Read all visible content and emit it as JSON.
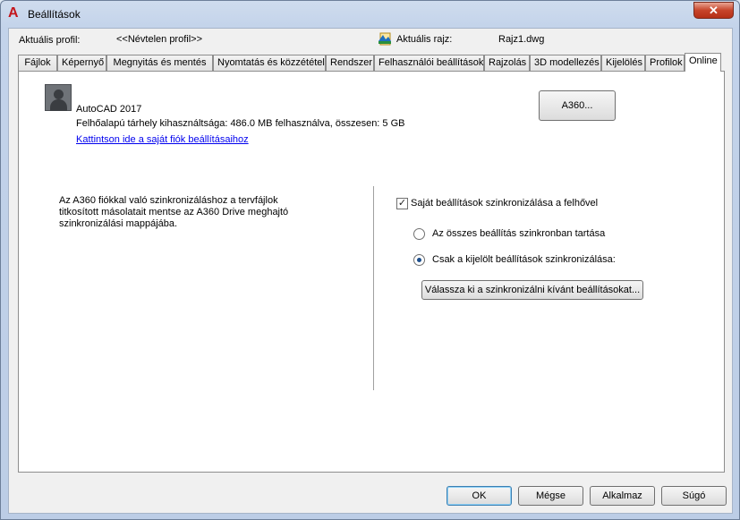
{
  "window": {
    "title": "Beállítások",
    "close_glyph": "✕"
  },
  "profile": {
    "current_profile_label": "Aktuális profil:",
    "current_profile_value": "<<Névtelen profil>>",
    "current_drawing_label": "Aktuális rajz:",
    "current_drawing_value": "Rajz1.dwg"
  },
  "tabs": [
    {
      "label": "Fájlok"
    },
    {
      "label": "Képernyő"
    },
    {
      "label": "Megnyitás és mentés"
    },
    {
      "label": "Nyomtatás és közzététel"
    },
    {
      "label": "Rendszer"
    },
    {
      "label": "Felhasználói beállítások"
    },
    {
      "label": "Rajzolás"
    },
    {
      "label": "3D modellezés"
    },
    {
      "label": "Kijelölés"
    },
    {
      "label": "Profilok"
    },
    {
      "label": "Online"
    }
  ],
  "online": {
    "product": "AutoCAD 2017",
    "storage_text": "Felhőalapú tárhely kihasználtsága: 486.0 MB felhasználva, összesen: 5 GB",
    "account_link": "Kattintson ide a saját fiók beállításaihoz",
    "a360_button": "A360...",
    "description": "Az A360 fiókkal való szinkronizáláshoz a tervfájlok titkosított másolatait mentse az A360 Drive meghajtó szinkronizálási mappájába.",
    "sync_checkbox_label": "Saját beállítások szinkronizálása a felhővel",
    "sync_checkbox_checked": true,
    "radio_all_label": "Az összes beállítás szinkronban tartása",
    "radio_selected_label": "Csak a kijelölt beállítások szinkronizálása:",
    "selected_radio": "selected",
    "choose_button": "Válassza ki a szinkronizálni kívánt beállításokat..."
  },
  "footer": {
    "ok": "OK",
    "cancel": "Mégse",
    "apply": "Alkalmaz",
    "help": "Súgó"
  },
  "colors": {
    "accent_link": "#0000ee",
    "app_icon_red": "#c4161c",
    "close_red": "#c7442a"
  },
  "icons": {
    "app": "autocad-a-icon",
    "drawing": "drawing-file-icon",
    "avatar": "user-avatar-icon"
  }
}
